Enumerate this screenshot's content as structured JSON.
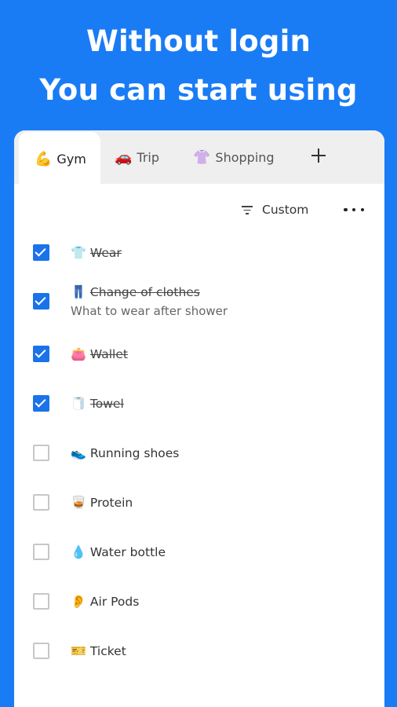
{
  "headline": {
    "line1": "Without login",
    "line2": "You can start using"
  },
  "tabs": [
    {
      "emoji": "💪",
      "label": "Gym",
      "active": true
    },
    {
      "emoji": "🚗",
      "label": "Trip",
      "active": false
    },
    {
      "emoji": "👚",
      "label": "Shopping",
      "active": false
    }
  ],
  "add_tab_icon": "plus-icon",
  "toolbar": {
    "sort_label": "Custom",
    "sort_icon": "filter-icon",
    "more_icon": "more-horizontal-icon"
  },
  "items": [
    {
      "emoji": "👕",
      "label": "Wear",
      "checked": true,
      "note": ""
    },
    {
      "emoji": "👖",
      "label": "Change of clothes",
      "checked": true,
      "note": "What to wear after shower"
    },
    {
      "emoji": "👛",
      "label": "Wallet",
      "checked": true,
      "note": ""
    },
    {
      "emoji": "🧻",
      "label": "Towel",
      "checked": true,
      "note": ""
    },
    {
      "emoji": "👟",
      "label": "Running shoes",
      "checked": false,
      "note": ""
    },
    {
      "emoji": "🥃",
      "label": "Protein",
      "checked": false,
      "note": ""
    },
    {
      "emoji": "💧",
      "label": "Water bottle",
      "checked": false,
      "note": ""
    },
    {
      "emoji": "👂",
      "label": "Air Pods",
      "checked": false,
      "note": ""
    },
    {
      "emoji": "🎫",
      "label": "Ticket",
      "checked": false,
      "note": ""
    }
  ],
  "colors": {
    "background": "#1a7cf5",
    "checkbox_checked": "#1a73e8",
    "checkbox_unchecked_border": "#c7c7c7",
    "tabbar": "#efefef"
  }
}
